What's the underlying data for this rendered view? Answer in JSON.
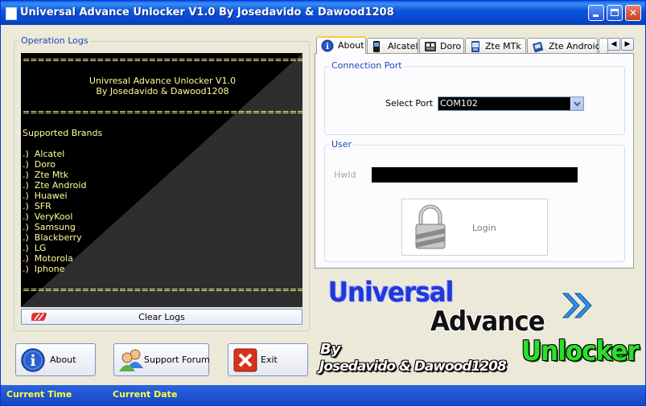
{
  "window": {
    "title": "Universal Advance Unlocker V1.0 By Josedavido & Dawood1208",
    "minimize_label": "_",
    "maximize_label": "",
    "close_label": "✕"
  },
  "logs": {
    "group_label": "Operation Logs",
    "lines": [
      "=========================================================",
      "",
      "Univresal Advance Unlocker V1.0",
      "By Josedavido & Dawood1208",
      "",
      "=========================================================",
      "",
      "Supported Brands",
      "",
      ".)  Alcatel",
      ".)  Doro",
      ".)  Zte Mtk",
      ".)  Zte Android",
      ".)  Huawei",
      ".)  SFR",
      ".)  VeryKool",
      ".)  Samsung",
      ".)  Blackberry",
      ".)  LG",
      ".)  Motorola",
      ".)  Iphone",
      "",
      "========================================================="
    ],
    "clear_button": "Clear Logs"
  },
  "tabs": {
    "items": [
      {
        "label": "About",
        "icon": "info-icon",
        "active": true
      },
      {
        "label": "Alcatel",
        "icon": "phone-icon",
        "active": false
      },
      {
        "label": "Doro",
        "icon": "phone-icon",
        "active": false
      },
      {
        "label": "Zte MTk",
        "icon": "phone-icon",
        "active": false
      },
      {
        "label": "Zte Android",
        "icon": "phone-icon",
        "active": false
      }
    ],
    "scroll_left": "◀",
    "scroll_right": "▶"
  },
  "connection": {
    "group_label": "Connection Port",
    "port_label": "Select Port",
    "port_value": "COM102"
  },
  "user": {
    "group_label": "User",
    "hwid_label": "HwId",
    "hwid_colon": ":",
    "hwid_value": "",
    "login_button": "Login"
  },
  "buttons": {
    "about": "About",
    "support": "Support Forum",
    "exit": "Exit"
  },
  "branding": {
    "word1": "Universal",
    "word2": "Advance",
    "word3": "Unlocker",
    "by": "By",
    "authors": "Josedavido & Dawood1208"
  },
  "status": {
    "time_label": "Current Time",
    "date_label": "Current Date"
  },
  "colors": {
    "titlebar": "#0a56dc",
    "log_text": "#ffff9a",
    "status_text": "#ffff40",
    "accent_blue": "#2138d8",
    "accent_green": "#2ae02a"
  }
}
